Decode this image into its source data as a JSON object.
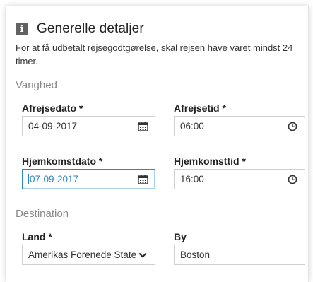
{
  "header": {
    "info_icon": "info-icon",
    "badge_glyph": "i",
    "title": "Generelle detaljer"
  },
  "intro": "For at få udbetalt rejsegodtgørelse, skal rejsen have varet mindst 24 timer.",
  "varighed": {
    "heading": "Varighed",
    "departure_date": {
      "label": "Afrejsedato *",
      "value": "04-09-2017",
      "icon": "calendar-icon"
    },
    "departure_time": {
      "label": "Afrejsetid *",
      "value": "06:00",
      "icon": "clock-icon"
    },
    "return_date": {
      "label": "Hjemkomstdato *",
      "value": "07-09-2017",
      "icon": "calendar-icon"
    },
    "return_time": {
      "label": "Hjemkomsttid *",
      "value": "16:00",
      "icon": "clock-icon"
    }
  },
  "destination": {
    "heading": "Destination",
    "country": {
      "label": "Land *",
      "value": "Amerikas Forenede Stater",
      "icon": "chevron-down-icon"
    },
    "city": {
      "label": "By",
      "value": "Boston"
    }
  },
  "colors": {
    "focus_border": "#2a86c8",
    "badge": "#626262",
    "section_heading": "#8a8a8a"
  }
}
